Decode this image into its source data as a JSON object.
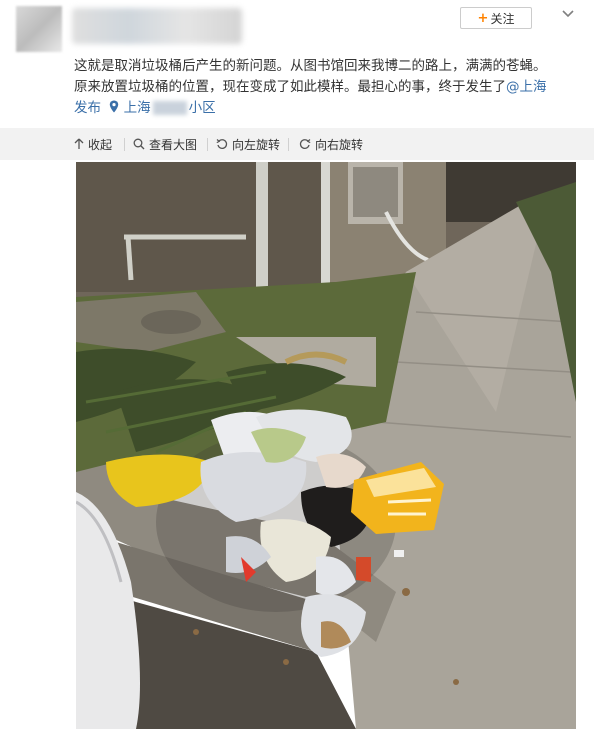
{
  "header": {
    "follow_label": "关注",
    "follow_plus": "+"
  },
  "post": {
    "line1": "这就是取消垃圾桶后产生的新问题。从图书馆回来我博二的路上，满满的苍蝇。",
    "line2_text": "原来放置垃圾桶的位置，现在变成了如此模样。最担心的事，终于发生了",
    "line2_mention": "@上海",
    "line3_mention": "发布",
    "location_prefix": "上海",
    "location_suffix": "小区"
  },
  "toolbar": {
    "collapse": "收起",
    "view_large": "查看大图",
    "rotate_left": "向左旋转",
    "rotate_right": "向右旋转"
  },
  "colors": {
    "accent_orange": "#ff8200",
    "link_blue": "#3a6fa8",
    "toolbar_bg": "#f2f2f2"
  }
}
